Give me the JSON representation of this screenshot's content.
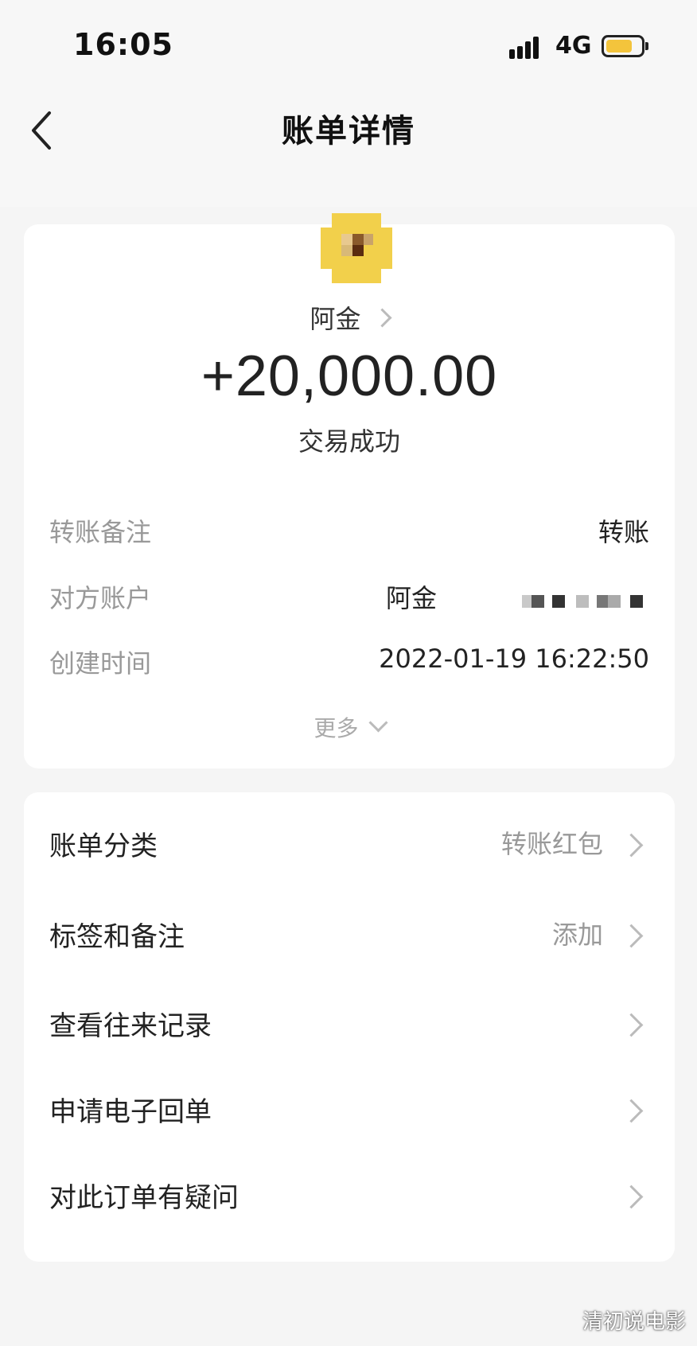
{
  "status_bar": {
    "time": "16:05",
    "network": "4G",
    "battery_level": 0.75
  },
  "nav": {
    "title": "账单详情"
  },
  "transaction": {
    "payee": "阿金",
    "amount": "+20,000.00",
    "status": "交易成功",
    "details": [
      {
        "label": "转账备注",
        "value": "转账"
      },
      {
        "label": "对方账户",
        "value": "阿金"
      },
      {
        "label": "创建时间",
        "value": "2022-01-19 16:22:50"
      }
    ],
    "more_label": "更多"
  },
  "actions": [
    {
      "label": "账单分类",
      "value": "转账红包"
    },
    {
      "label": "标签和备注",
      "value": "添加"
    },
    {
      "label": "查看往来记录",
      "value": ""
    },
    {
      "label": "申请电子回单",
      "value": ""
    },
    {
      "label": "对此订单有疑问",
      "value": ""
    }
  ],
  "watermark": "清初说电影",
  "colors": {
    "background": "#f5f5f5",
    "card": "#ffffff",
    "avatar": "#f2d04b",
    "muted": "#999999"
  }
}
